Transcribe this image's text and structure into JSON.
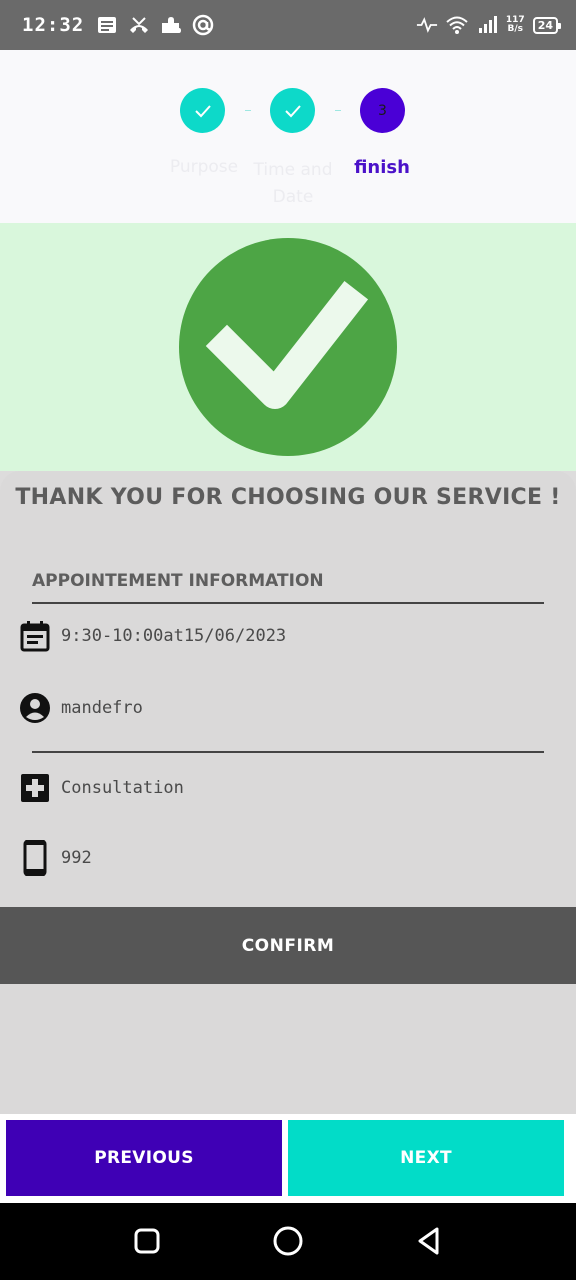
{
  "status_bar": {
    "time": "12:32",
    "net_speed_top": "117",
    "net_speed_bottom": "B/s",
    "battery": "24",
    "icons": [
      "message-icon",
      "missed-call-icon",
      "puzzle-icon",
      "at-sign-icon",
      "activity-icon",
      "wifi-icon",
      "signal-icon",
      "battery-icon"
    ]
  },
  "stepper": {
    "steps": [
      {
        "label": "Purpose",
        "state": "done",
        "icon": "check-icon"
      },
      {
        "label": "Time and Date",
        "state": "done",
        "icon": "check-icon"
      },
      {
        "label": "finish",
        "state": "current",
        "number": "3"
      }
    ],
    "colors": {
      "done": "#0dd9c9",
      "current": "#4a00d6"
    }
  },
  "hero": {
    "icon": "success-check-icon",
    "color": "#4da545",
    "background": "#d9f7dc"
  },
  "card": {
    "thanks": "THANK YOU FOR CHOOSING OUR SERVICE !",
    "section_title": "APPOINTEMENT INFORMATION",
    "rows": [
      {
        "icon": "calendar-icon",
        "text": "9:30-10:00at15/06/2023"
      },
      {
        "icon": "account-circle-icon",
        "text": "mandefro"
      },
      {
        "icon": "medical-plus-icon",
        "text": "Consultation"
      },
      {
        "icon": "phone-icon",
        "text": "992"
      }
    ],
    "confirm_label": "CONFIRM"
  },
  "nav": {
    "previous_label": "PREVIOUS",
    "next_label": "NEXT",
    "previous_color": "#3f00b5",
    "next_color": "#02dcc8"
  },
  "system_nav": {
    "icons": [
      "recents-icon",
      "home-icon",
      "back-icon"
    ]
  }
}
